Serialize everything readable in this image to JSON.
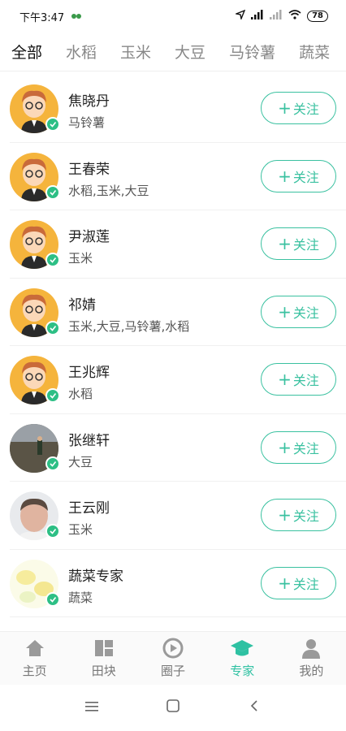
{
  "status": {
    "time": "下午3:47",
    "battery": "78"
  },
  "tabs": [
    {
      "label": "全部",
      "active": true
    },
    {
      "label": "水稻"
    },
    {
      "label": "玉米"
    },
    {
      "label": "大豆"
    },
    {
      "label": "马铃薯"
    },
    {
      "label": "蔬菜"
    }
  ],
  "experts": [
    {
      "name": "焦晓丹",
      "crops": "马铃薯",
      "avatar": "cartoon-avatar",
      "follow_label": "关注"
    },
    {
      "name": "王春荣",
      "crops": "水稻,玉米,大豆",
      "avatar": "cartoon-avatar",
      "follow_label": "关注"
    },
    {
      "name": "尹淑莲",
      "crops": "玉米",
      "avatar": "cartoon-avatar",
      "follow_label": "关注"
    },
    {
      "name": "祁婧",
      "crops": "玉米,大豆,马铃薯,水稻",
      "avatar": "cartoon-avatar",
      "follow_label": "关注"
    },
    {
      "name": "王兆辉",
      "crops": "水稻",
      "avatar": "cartoon-avatar",
      "follow_label": "关注"
    },
    {
      "name": "张继轩",
      "crops": "大豆",
      "avatar": "field-photo-avatar",
      "follow_label": "关注"
    },
    {
      "name": "王云刚",
      "crops": "玉米",
      "avatar": "portrait-photo-avatar",
      "follow_label": "关注"
    },
    {
      "name": "蔬菜专家",
      "crops": "蔬菜",
      "avatar": "lemon-photo-avatar",
      "follow_label": "关注"
    }
  ],
  "bottom_nav": [
    {
      "label": "主页",
      "icon": "home-icon"
    },
    {
      "label": "田块",
      "icon": "field-blocks-icon"
    },
    {
      "label": "圈子",
      "icon": "circle-play-icon"
    },
    {
      "label": "专家",
      "icon": "graduation-cap-icon",
      "active": true
    },
    {
      "label": "我的",
      "icon": "user-icon"
    }
  ],
  "colors": {
    "accent": "#3ac1a0",
    "badge": "#2dbf85"
  }
}
